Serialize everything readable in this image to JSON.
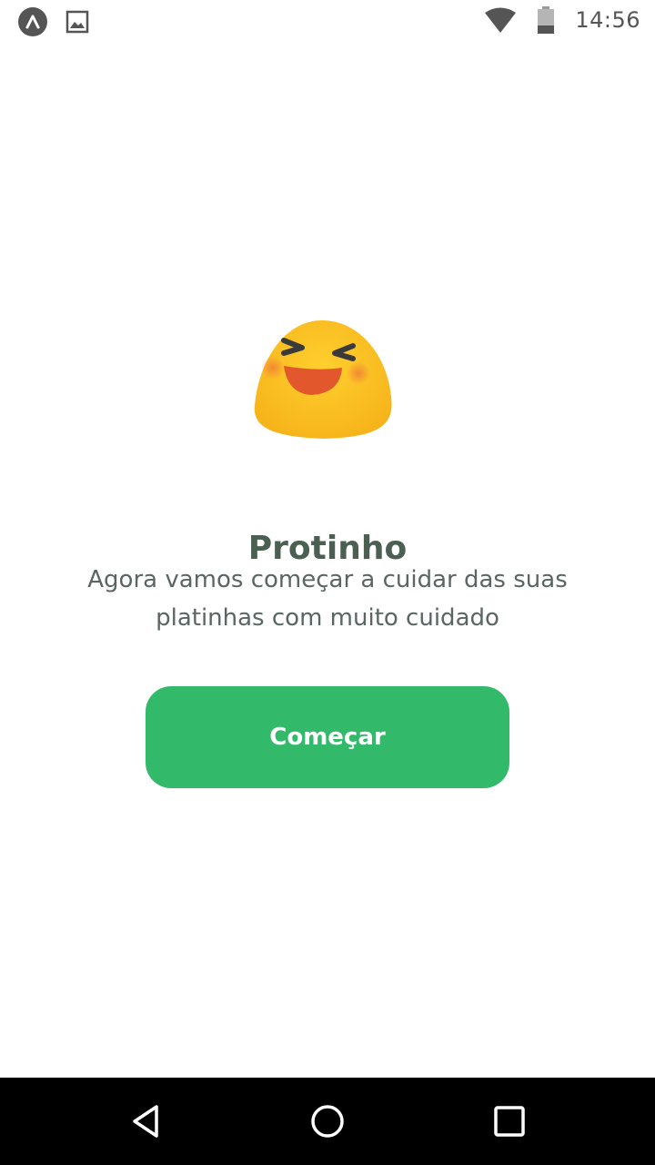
{
  "status_bar": {
    "time": "14:56",
    "left_icons": [
      "expo-icon",
      "image-icon"
    ],
    "right_icons": [
      "wifi-icon",
      "battery-icon"
    ]
  },
  "main": {
    "emoji_icon": "laughing-face-icon",
    "title": "Protinho",
    "subtitle": "Agora vamos começar a cuidar das suas platinhas com muito cuidado",
    "start_button_label": "Começar"
  },
  "nav_bar": {
    "icons": [
      "back-icon",
      "home-icon",
      "recents-icon"
    ]
  },
  "colors": {
    "primary_button": "#33b96a",
    "title_text": "#4b5f52",
    "body_text": "#5a6663",
    "nav_bar": "#000000"
  }
}
